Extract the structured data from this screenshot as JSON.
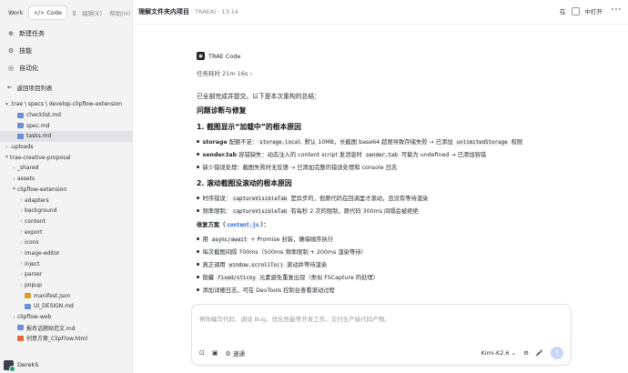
{
  "top_tabs": [
    {
      "label": "Work"
    },
    {
      "label": "Code"
    }
  ],
  "menu": [
    "编辑(E)",
    "帮助(H)"
  ],
  "nav": [
    {
      "icon": "new-task-icon",
      "label": "新建任务"
    },
    {
      "icon": "skill-icon",
      "label": "技能"
    },
    {
      "icon": "automation-icon",
      "label": "自动化"
    }
  ],
  "back_label": "返回项目列表",
  "tree": [
    {
      "indent": 0,
      "chev": "▾",
      "icon": "folder",
      "label": ".trae \\ specs \\ develop-clipflow-extension"
    },
    {
      "indent": 1,
      "chev": "",
      "icon": "md",
      "label": "checklist.md"
    },
    {
      "indent": 1,
      "chev": "",
      "icon": "md",
      "label": "spec.md"
    },
    {
      "indent": 1,
      "chev": "",
      "icon": "md",
      "label": "tasks.md",
      "selected": true
    },
    {
      "indent": 0,
      "chev": "›",
      "icon": "folder",
      "label": ".uploads"
    },
    {
      "indent": 0,
      "chev": "▾",
      "icon": "folder",
      "label": "trae-creative-proposal"
    },
    {
      "indent": 1,
      "chev": "›",
      "icon": "folder",
      "label": "_shared"
    },
    {
      "indent": 1,
      "chev": "›",
      "icon": "folder",
      "label": "assets"
    },
    {
      "indent": 1,
      "chev": "▾",
      "icon": "folder",
      "label": "clipflow-extension"
    },
    {
      "indent": 2,
      "chev": "›",
      "icon": "folder",
      "label": "adapters"
    },
    {
      "indent": 2,
      "chev": "›",
      "icon": "folder",
      "label": "background"
    },
    {
      "indent": 2,
      "chev": "›",
      "icon": "folder",
      "label": "content"
    },
    {
      "indent": 2,
      "chev": "›",
      "icon": "folder",
      "label": "export"
    },
    {
      "indent": 2,
      "chev": "›",
      "icon": "folder",
      "label": "icons"
    },
    {
      "indent": 2,
      "chev": "›",
      "icon": "folder",
      "label": "image-editor"
    },
    {
      "indent": 2,
      "chev": "›",
      "icon": "folder",
      "label": "inject"
    },
    {
      "indent": 2,
      "chev": "›",
      "icon": "folder",
      "label": "parser"
    },
    {
      "indent": 2,
      "chev": "›",
      "icon": "folder",
      "label": "popup"
    },
    {
      "indent": 2,
      "chev": "",
      "icon": "json",
      "label": "manifest.json"
    },
    {
      "indent": 2,
      "chev": "",
      "icon": "md",
      "label": "UI_DESIGN.md"
    },
    {
      "indent": 1,
      "chev": "›",
      "icon": "folder",
      "label": "clipflow-web"
    },
    {
      "indent": 1,
      "chev": "",
      "icon": "md",
      "label": "报名话题贴范文.md"
    },
    {
      "indent": 1,
      "chev": "",
      "icon": "html",
      "label": "创意方案_ClipFlow.html"
    }
  ],
  "user": {
    "name": "DerekS"
  },
  "header": {
    "title": "理解文件夹内项目",
    "subtitle": "TRAEAI · 13:14",
    "right_prefix": "在",
    "open_label": "中打开"
  },
  "bot": {
    "name": "TRAE Code"
  },
  "elapsed": "任务耗时 21m 16s",
  "content": {
    "intro": "已全部完成并提交。以下是本次重构的总结：",
    "h_diag": "问题诊断与修复",
    "h1": "1. 截图显示“加载中”的根本原因",
    "b1": {
      "a": "storage",
      "b": " 配额不足：",
      "c": "storage.local",
      "d": " 默认 10MB，长截图 base64 超限导致存储失败 → 已添加 ",
      "e": "unlimitedStorage",
      "f": " 权限"
    },
    "b2": {
      "a": "sender.tab",
      "b": " 容错缺失：动态注入的 content script 发消息时 ",
      "c": "sender.tab",
      "d": " 可能为 undefined → 已添加容错"
    },
    "b3": "缺少错误处理：截图失败时无反馈 → 已添加完整的错误处理和 console 日志",
    "h2": "2. 滚动截图没滚动的根本原因",
    "b4": {
      "a": "时序错误：",
      "b": "captureVisibleTab",
      "c": " 是异步的，但原代码在回调里才滚动，且没有等待渲染"
    },
    "b5": {
      "a": "频率限制：",
      "b": "captureVisibleTab",
      "c": " 有每秒 2 次的限制，原代码 300ms 间隔会被拒绝"
    },
    "fix_title": {
      "a": "修复方案（",
      "b": "content.js",
      "c": "）："
    },
    "f1": {
      "a": "用 ",
      "b": "async/await",
      "c": " + Promise 封装，确保顺序执行"
    },
    "f2": "每次截图间隔 700ms（500ms 频率限制 + 200ms 渲染等待）",
    "f3": {
      "a": "真正调用 ",
      "b": "window.scrollTo()",
      "c": " 滚动并等待渲染"
    },
    "f4": {
      "a": "隐藏 ",
      "b": "fixed/sticky",
      "c": " 元素避免重复出现（类似 FSCapture 的处理）"
    },
    "f5": "添加详细日志，可在 DevTools 控制台查看滚动过程"
  },
  "input": {
    "placeholder": "帮你编写代码、调试 Bug、优化性能等开发工作。交付生产级代码产物。",
    "speed_label": "速通",
    "model": "Kimi-K2.6"
  }
}
